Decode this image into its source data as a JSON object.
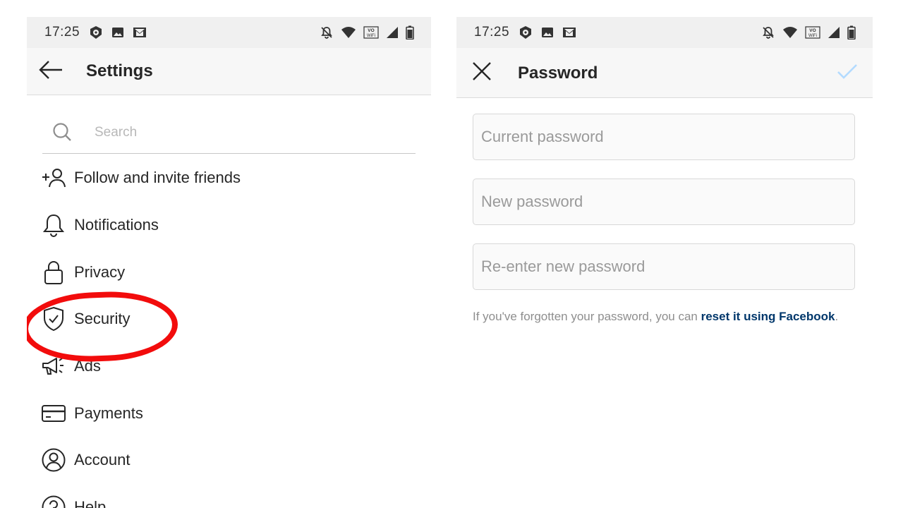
{
  "colors": {
    "status_bar_bg": "#f0f0f0",
    "app_bar_bg": "#f7f7f7",
    "highlight_ring": "#f20c0c",
    "link_color": "#00376b",
    "check_disabled": "#b3dbff"
  },
  "left_screen": {
    "status_bar": {
      "time": "17:25",
      "left_icons": [
        "notification-app-icon",
        "image-icon",
        "gmail-icon"
      ],
      "right_icons": [
        "notifications-off-icon",
        "wifi-icon",
        "vowifi-icon",
        "signal-icon",
        "battery-icon"
      ]
    },
    "app_bar": {
      "back_icon": "arrow-left-icon",
      "title": "Settings"
    },
    "search": {
      "icon": "search-icon",
      "placeholder": "Search"
    },
    "menu_items": [
      {
        "icon": "add-person-icon",
        "label": "Follow and invite friends"
      },
      {
        "icon": "bell-icon",
        "label": "Notifications"
      },
      {
        "icon": "lock-icon",
        "label": "Privacy"
      },
      {
        "icon": "shield-check-icon",
        "label": "Security"
      },
      {
        "icon": "megaphone-icon",
        "label": "Ads"
      },
      {
        "icon": "credit-card-icon",
        "label": "Payments"
      },
      {
        "icon": "account-circle-icon",
        "label": "Account"
      },
      {
        "icon": "help-icon",
        "label": "Help"
      }
    ],
    "highlighted_item": "Security"
  },
  "right_screen": {
    "status_bar": {
      "time": "17:25",
      "left_icons": [
        "notification-app-icon",
        "image-icon",
        "gmail-icon"
      ],
      "right_icons": [
        "notifications-off-icon",
        "wifi-icon",
        "vowifi-icon",
        "signal-icon",
        "battery-icon"
      ]
    },
    "app_bar": {
      "close_icon": "close-icon",
      "title": "Password",
      "confirm_icon": "checkmark-icon"
    },
    "fields": {
      "current_password": {
        "placeholder": "Current password",
        "value": ""
      },
      "new_password": {
        "placeholder": "New password",
        "value": ""
      },
      "reenter_password": {
        "placeholder": "Re-enter new password",
        "value": ""
      }
    },
    "forgot": {
      "prefix": "If you've forgotten your password, you can ",
      "link": "reset it using Facebook",
      "suffix": "."
    }
  }
}
